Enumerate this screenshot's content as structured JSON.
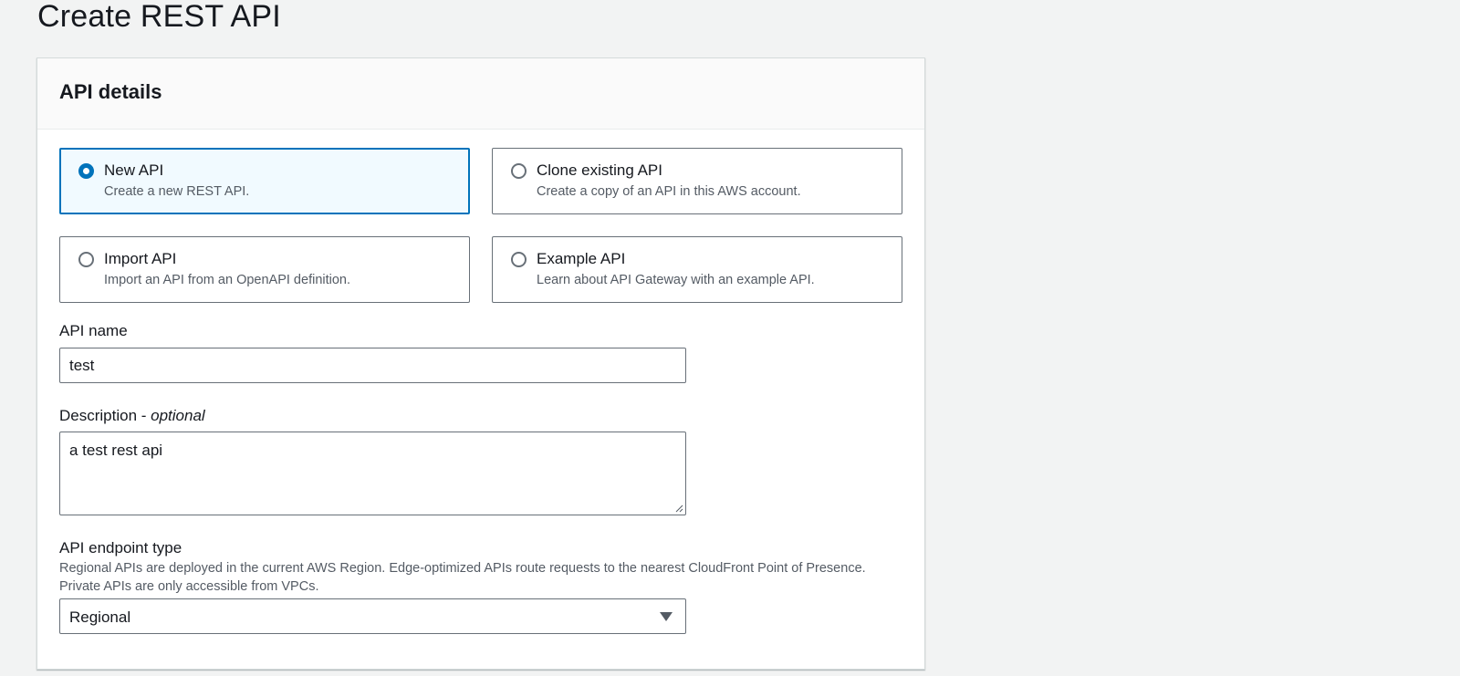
{
  "page": {
    "title": "Create REST API"
  },
  "panel": {
    "title": "API details",
    "options": [
      {
        "label": "New API",
        "description": "Create a new REST API.",
        "selected": true
      },
      {
        "label": "Clone existing API",
        "description": "Create a copy of an API in this AWS account.",
        "selected": false
      },
      {
        "label": "Import API",
        "description": "Import an API from an OpenAPI definition.",
        "selected": false
      },
      {
        "label": "Example API",
        "description": "Learn about API Gateway with an example API.",
        "selected": false
      }
    ]
  },
  "api_name": {
    "label": "API name",
    "value": "test"
  },
  "description": {
    "label": "Description - ",
    "optional": "optional",
    "value": "a test rest api"
  },
  "endpoint_type": {
    "label": "API endpoint type",
    "help_line1": "Regional APIs are deployed in the current AWS Region. Edge-optimized APIs route requests to the nearest CloudFront Point of Presence.",
    "help_line2": "Private APIs are only accessible from VPCs.",
    "selected": "Regional"
  },
  "colors": {
    "accent": "#0073bb",
    "selected_bg": "#f1faff",
    "border": "#687078",
    "page_bg": "#f2f3f3"
  }
}
